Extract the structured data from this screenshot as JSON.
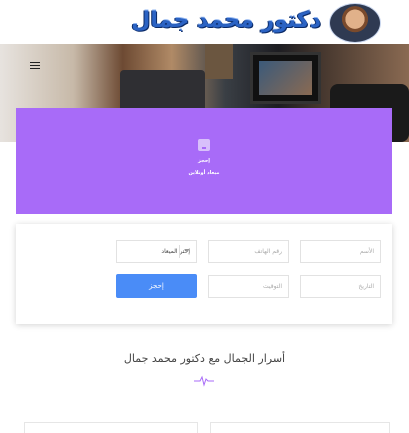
{
  "header": {
    "logo_text": "دكتور محمد جمال",
    "avatar": "doctor-avatar"
  },
  "hero": {
    "menu_icon": "hamburger-icon"
  },
  "booking_banner": {
    "icon": "download-icon",
    "line1": "إحجز",
    "line2": "ميعاد أونلاين",
    "accent": "#a86bf8"
  },
  "booking_form": {
    "name_placeholder": "الأسم",
    "phone_placeholder": "رقم الهاتف",
    "appointment_select": "إختر الميعاد",
    "date_placeholder": "التاريخ",
    "time_placeholder": "التوقيت",
    "submit_label": "إحجز",
    "submit_color": "#4a8cf7"
  },
  "section": {
    "title": "أسرار الجمال مع دكتور محمد جمال",
    "icon": "pulse-icon"
  }
}
